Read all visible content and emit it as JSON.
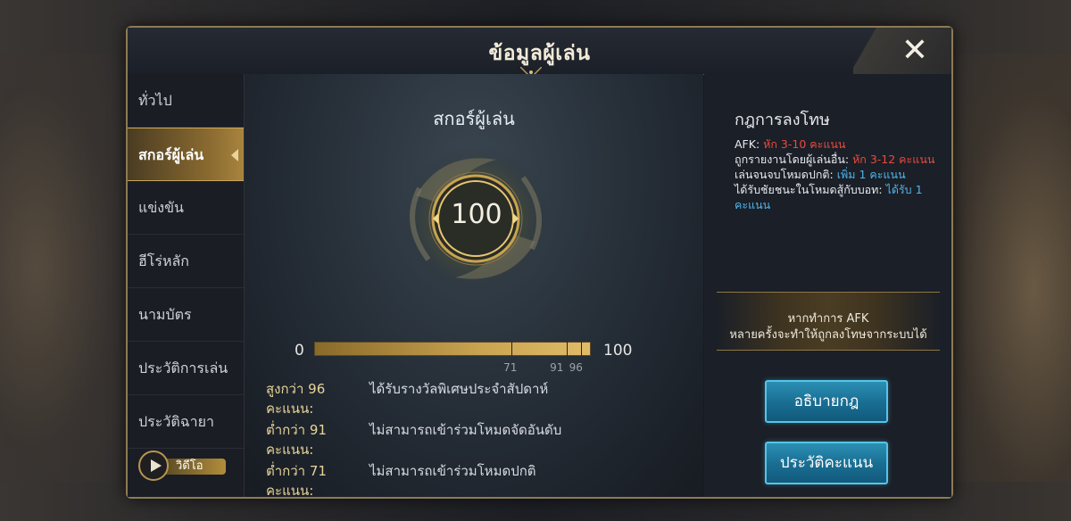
{
  "window": {
    "title": "ข้อมูลผู้เล่น",
    "close_label": "✕"
  },
  "sidebar": {
    "items": [
      {
        "label": "ทั่วไป",
        "active": false
      },
      {
        "label": "สกอร์ผู้เล่น",
        "active": true
      },
      {
        "label": "แข่งขัน",
        "active": false
      },
      {
        "label": "ฮีโร่หลัก",
        "active": false
      },
      {
        "label": "นามบัตร",
        "active": false
      },
      {
        "label": "ประวัติการเล่น",
        "active": false
      },
      {
        "label": "ประวัติฉายา",
        "active": false
      }
    ],
    "video_label": "วิดีโอ"
  },
  "score_panel": {
    "title": "สกอร์ผู้เล่น",
    "score": "100",
    "bar": {
      "min": "0",
      "max": "100",
      "value": 100,
      "tick_labels": [
        "71",
        "91",
        "96"
      ]
    },
    "rules": [
      {
        "condition": "สูงกว่า 96 คะแนน:",
        "effect": "ได้รับรางวัลพิเศษประจำสัปดาห์"
      },
      {
        "condition": "ต่ำกว่า 91 คะแนน:",
        "effect": "ไม่สามารถเข้าร่วมโหมดจัดอันดับ"
      },
      {
        "condition": "ต่ำกว่า 71 คะแนน:",
        "effect": "ไม่สามารถเข้าร่วมโหมดปกติ"
      }
    ]
  },
  "penalty_panel": {
    "title": "กฎการลงโทษ",
    "lines": [
      {
        "label": "AFK: ",
        "value": "หัก 3-10 คะแนน"
      },
      {
        "label": "ถูกรายงานโดยผู้เล่นอื่น: ",
        "value": "หัก 3-12 คะแนน"
      },
      {
        "label": "เล่นจนจบโหมดปกติ: ",
        "value": "เพิ่ม 1 คะแนน"
      },
      {
        "label": "ได้รับชัยชนะในโหมดสู้กับบอท: ",
        "value": "ได้รับ 1 คะแนน"
      }
    ],
    "afk_warning": {
      "line1": "หากทำการ AFK",
      "line2": "หลายครั้งจะทำให้ถูกลงโทษจากระบบได้"
    },
    "explain_button": "อธิบายกฎ",
    "history_button": "ประวัติคะแนน"
  },
  "colors": {
    "accent_gold": "#c9a350",
    "penalty_red": "#e84a3f",
    "bonus_blue": "#4fb4e8",
    "button_blue": "#1a6f94"
  }
}
